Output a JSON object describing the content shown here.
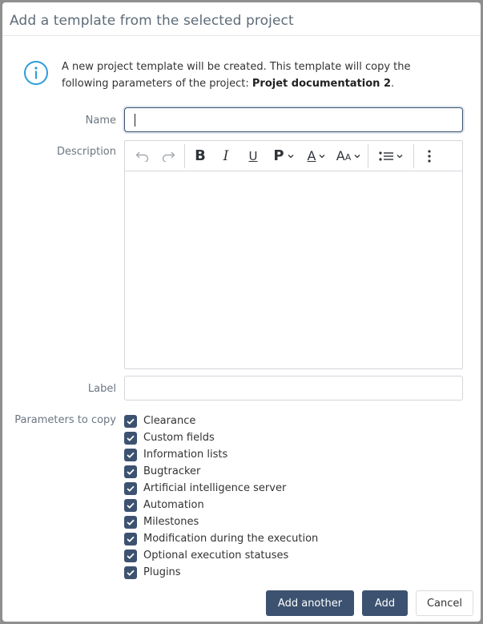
{
  "dialog": {
    "title": "Add a template from the selected project",
    "info": {
      "icon": "info-circle-icon",
      "text_prefix": "A new project template will be created. This template will copy the following parameters of the project: ",
      "project_name": "Projet documentation 2",
      "text_suffix": "."
    },
    "form": {
      "name": {
        "label": "Name",
        "value": ""
      },
      "description": {
        "label": "Description",
        "value": "",
        "toolbar": [
          {
            "name": "undo",
            "icon": "undo-icon"
          },
          {
            "name": "redo",
            "icon": "redo-icon"
          },
          {
            "name": "bold",
            "icon": "bold-icon",
            "glyph": "B"
          },
          {
            "name": "italic",
            "icon": "italic-icon",
            "glyph": "I"
          },
          {
            "name": "underline",
            "icon": "underline-icon",
            "glyph": "U"
          },
          {
            "name": "paragraph",
            "icon": "paragraph-icon",
            "glyph": "P",
            "dropdown": true
          },
          {
            "name": "font-color",
            "icon": "font-color-icon",
            "glyph": "A",
            "dropdown": true
          },
          {
            "name": "font-size",
            "icon": "font-size-icon",
            "glyph": "AA",
            "dropdown": true
          },
          {
            "name": "list",
            "icon": "bulleted-list-icon",
            "dropdown": true
          },
          {
            "name": "more",
            "icon": "more-vertical-icon"
          }
        ]
      },
      "label": {
        "label": "Label",
        "value": ""
      },
      "parameters": {
        "label": "Parameters to copy",
        "items": [
          {
            "label": "Clearance",
            "checked": true
          },
          {
            "label": "Custom fields",
            "checked": true
          },
          {
            "label": "Information lists",
            "checked": true
          },
          {
            "label": "Bugtracker",
            "checked": true
          },
          {
            "label": "Artificial intelligence server",
            "checked": true
          },
          {
            "label": "Automation",
            "checked": true
          },
          {
            "label": "Milestones",
            "checked": true
          },
          {
            "label": "Modification during the execution",
            "checked": true
          },
          {
            "label": "Optional execution statuses",
            "checked": true
          },
          {
            "label": "Plugins",
            "checked": true
          }
        ]
      }
    },
    "buttons": {
      "add_another": "Add another",
      "add": "Add",
      "cancel": "Cancel"
    },
    "colors": {
      "primary": "#3c5270",
      "info_icon": "#2d9cdb"
    }
  }
}
